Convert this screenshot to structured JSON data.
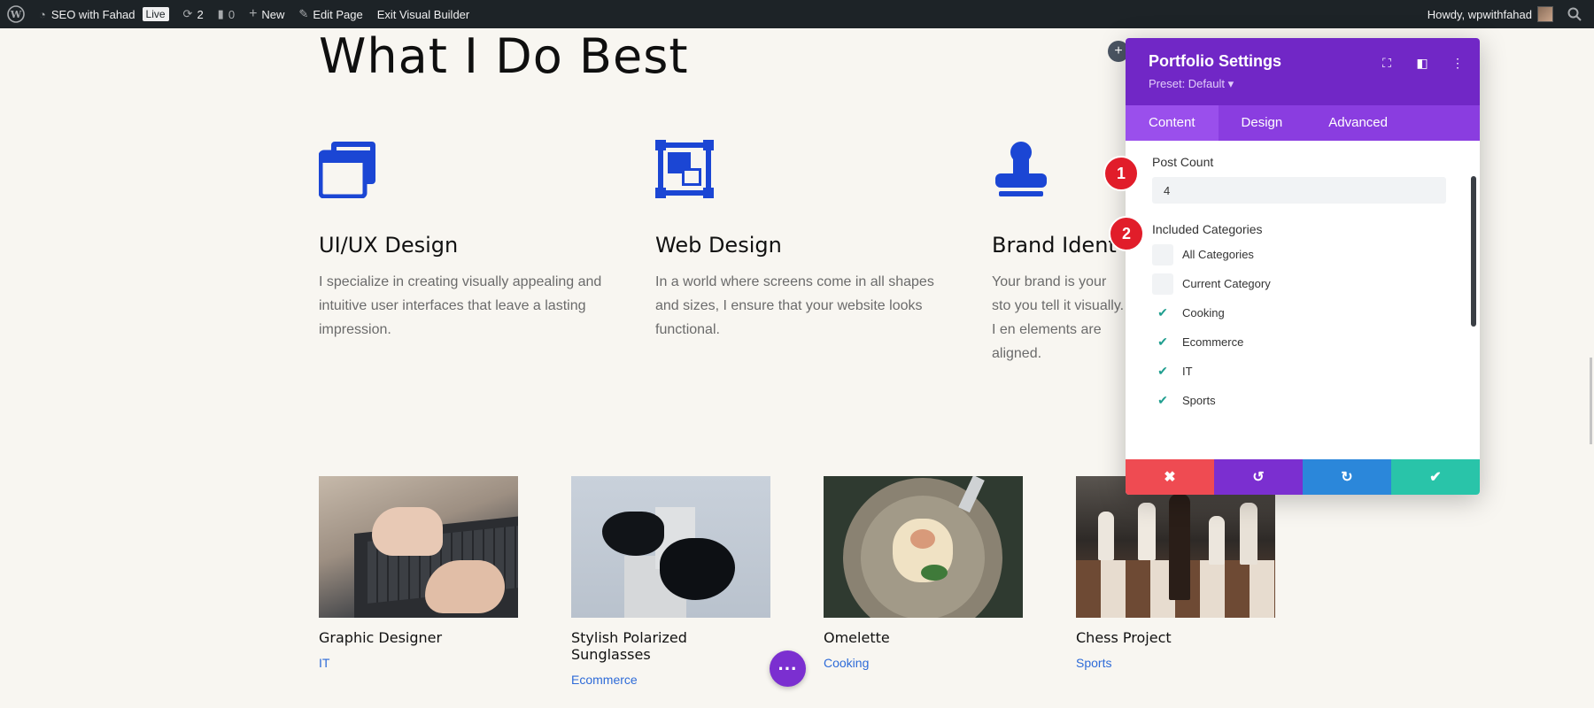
{
  "adminbar": {
    "site_name": "SEO with Fahad",
    "live_label": "Live",
    "updates_count": "2",
    "comments_count": "0",
    "new_label": "New",
    "edit_page_label": "Edit Page",
    "exit_builder_label": "Exit Visual Builder",
    "howdy_label": "Howdy, wpwithfahad"
  },
  "page": {
    "heading": "What I Do Best",
    "services": [
      {
        "title": "UI/UX Design",
        "text": "I specialize in creating visually appealing and intuitive user interfaces that leave a lasting impression.",
        "icon": "windows-icon"
      },
      {
        "title": "Web Design",
        "text": "In a world where screens come in all shapes and sizes, I ensure that your website looks functional.",
        "icon": "frame-icon"
      },
      {
        "title": "Brand Ident",
        "text": "Your brand is your sto you tell it visually. I en elements are aligned.",
        "icon": "stamp-icon"
      }
    ],
    "portfolio": [
      {
        "title": "Graphic Designer",
        "category": "IT"
      },
      {
        "title": "Stylish Polarized Sunglasses",
        "category": "Ecommerce"
      },
      {
        "title": "Omelette",
        "category": "Cooking"
      },
      {
        "title": "Chess Project",
        "category": "Sports"
      }
    ]
  },
  "panel": {
    "title": "Portfolio Settings",
    "preset": "Preset: Default ▾",
    "tabs": [
      "Content",
      "Design",
      "Advanced"
    ],
    "post_count_label": "Post Count",
    "post_count_value": "4",
    "included_categories_label": "Included Categories",
    "categories": [
      {
        "label": "All Categories",
        "checked": false
      },
      {
        "label": "Current Category",
        "checked": false
      },
      {
        "label": "Cooking",
        "checked": true
      },
      {
        "label": "Ecommerce",
        "checked": true
      },
      {
        "label": "IT",
        "checked": true
      },
      {
        "label": "Sports",
        "checked": true
      }
    ],
    "badges": [
      "1",
      "2"
    ]
  },
  "colors": {
    "panel_header": "#7127c6",
    "panel_tabs": "#8a3de0",
    "cancel": "#ef4b52",
    "undo": "#7b2fd0",
    "redo": "#2b87da",
    "save": "#29c4a9",
    "icon_blue": "#1b46d4"
  }
}
